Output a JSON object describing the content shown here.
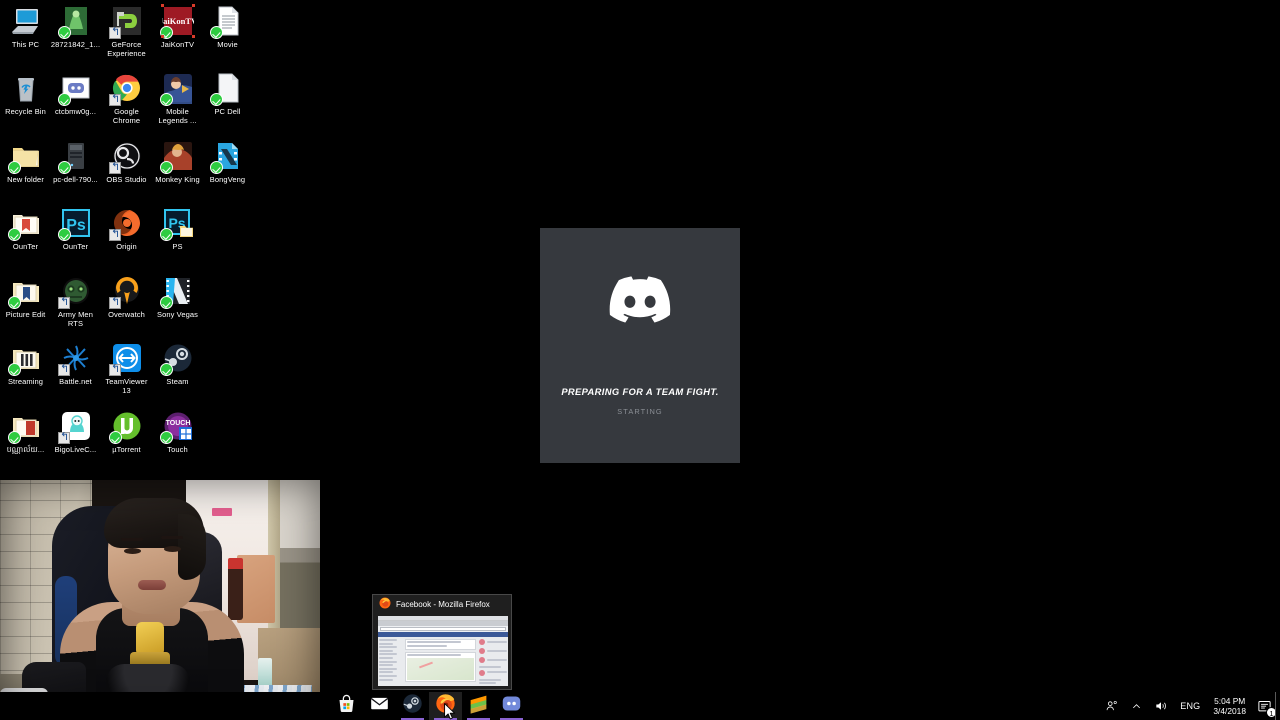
{
  "desktop": {
    "background_color": "#000000",
    "icons": [
      {
        "label": "This PC",
        "icon": "this-pc-icon",
        "badge": "none",
        "selected": false
      },
      {
        "label": "28721842_1...",
        "icon": "image-thumbnail-icon",
        "badge": "check",
        "selected": false
      },
      {
        "label": "GeForce Experience",
        "icon": "geforce-experience-icon",
        "badge": "shortcut",
        "selected": false
      },
      {
        "label": "JaiKonTV",
        "icon": "jaikontv-icon",
        "badge": "check",
        "selected": true
      },
      {
        "label": "Movie",
        "icon": "text-document-icon",
        "badge": "check",
        "selected": false
      },
      {
        "label": "Recycle Bin",
        "icon": "recycle-bin-icon",
        "badge": "none",
        "selected": false
      },
      {
        "label": "ctcbmw0g...",
        "icon": "discord-image-icon",
        "badge": "check",
        "selected": false
      },
      {
        "label": "Google Chrome",
        "icon": "google-chrome-icon",
        "badge": "shortcut",
        "selected": false
      },
      {
        "label": "Mobile Legends ...",
        "icon": "mobile-legends-icon",
        "badge": "check",
        "selected": false
      },
      {
        "label": "PC Dell",
        "icon": "blank-document-icon",
        "badge": "check",
        "selected": false
      },
      {
        "label": "New folder",
        "icon": "folder-icon",
        "badge": "check",
        "selected": false
      },
      {
        "label": "pc-dell-790...",
        "icon": "computer-tower-icon",
        "badge": "check",
        "selected": false
      },
      {
        "label": "OBS Studio",
        "icon": "obs-studio-icon",
        "badge": "shortcut",
        "selected": false
      },
      {
        "label": "Monkey King",
        "icon": "monkey-king-icon",
        "badge": "check",
        "selected": false
      },
      {
        "label": "BongVeng",
        "icon": "video-file-icon",
        "badge": "check",
        "selected": false
      },
      {
        "label": "OunTer",
        "icon": "folder-open-icon",
        "badge": "check",
        "selected": false
      },
      {
        "label": "OunTer",
        "icon": "photoshop-icon",
        "badge": "check",
        "selected": false
      },
      {
        "label": "Origin",
        "icon": "origin-icon",
        "badge": "shortcut",
        "selected": false
      },
      {
        "label": "PS",
        "icon": "photoshop-folder-icon",
        "badge": "check",
        "selected": false
      },
      {
        "label": "Picture Edit",
        "icon": "folder-picture-icon",
        "badge": "check",
        "selected": false
      },
      {
        "label": "Army Men RTS",
        "icon": "army-men-rts-icon",
        "badge": "shortcut",
        "selected": false
      },
      {
        "label": "Overwatch",
        "icon": "overwatch-icon",
        "badge": "shortcut",
        "selected": false
      },
      {
        "label": "Sony Vegas",
        "icon": "sony-vegas-icon",
        "badge": "check",
        "selected": false
      },
      {
        "label": "Streaming",
        "icon": "folder-stripe-icon",
        "badge": "check",
        "selected": false
      },
      {
        "label": "Battle.net",
        "icon": "battlenet-icon",
        "badge": "shortcut",
        "selected": false
      },
      {
        "label": "TeamViewer 13",
        "icon": "teamviewer-icon",
        "badge": "shortcut",
        "selected": false
      },
      {
        "label": "Steam",
        "icon": "steam-icon",
        "badge": "check",
        "selected": false
      },
      {
        "label": "បណ្ណាល័យ...",
        "icon": "folder-red-doc-icon",
        "badge": "check",
        "selected": false
      },
      {
        "label": "BigoLiveC...",
        "icon": "bigo-live-icon",
        "badge": "shortcut",
        "selected": false
      },
      {
        "label": "µTorrent",
        "icon": "utorrent-icon",
        "badge": "check",
        "selected": false
      },
      {
        "label": "Touch",
        "icon": "touch-icon",
        "badge": "check",
        "selected": false
      }
    ]
  },
  "discord_splash": {
    "app_name": "Discord",
    "logo_icon": "discord-logo-icon",
    "tagline": "PREPARING FOR A TEAM FIGHT.",
    "status": "STARTING",
    "background_color": "#36393e",
    "status_color": "#8b8f95"
  },
  "webcam_overlay": {
    "label": "webcam-stream-overlay",
    "description": "Live streamer webcam feed"
  },
  "thumbnail_preview": {
    "title": "Facebook - Mozilla Firefox",
    "icon": "firefox-icon"
  },
  "taskbar": {
    "background_color": "#000000",
    "apps": [
      {
        "name": "Microsoft Store",
        "icon": "microsoft-store-icon",
        "running": false,
        "active": false
      },
      {
        "name": "Mail",
        "icon": "mail-icon",
        "running": false,
        "active": false
      },
      {
        "name": "Steam",
        "icon": "steam-icon",
        "running": true,
        "active": false
      },
      {
        "name": "Mozilla Firefox",
        "icon": "firefox-icon",
        "running": true,
        "active": true
      },
      {
        "name": "Sublime Text",
        "icon": "sublime-text-icon",
        "running": true,
        "active": false
      },
      {
        "name": "Discord",
        "icon": "discord-icon",
        "running": true,
        "active": false
      }
    ],
    "tray": {
      "people_icon": "people-icon",
      "chevron_icon": "chevron-up-icon",
      "volume_icon": "speaker-icon",
      "language": "ENG",
      "time": "5:04 PM",
      "date": "3/4/2018",
      "notification_icon": "action-center-icon",
      "notification_count": "1"
    }
  }
}
